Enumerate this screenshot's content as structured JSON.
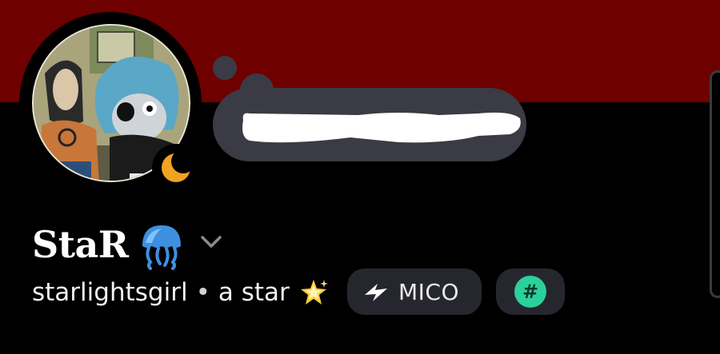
{
  "profile": {
    "display_name": "StaR",
    "name_emoji": "jellyfish-emoji",
    "username": "starlightsgirl",
    "separator": "•",
    "pronouns": "a star",
    "pronouns_emoji": "sparkle-star-emoji",
    "status": "idle-moon-icon",
    "custom_status": ""
  },
  "badges": [
    {
      "label": "MICO",
      "icon": "lightning-icon"
    },
    {
      "label": "#",
      "icon": "hashtag-icon"
    }
  ],
  "colors": {
    "banner": "#6e0000",
    "background": "#000000",
    "pill": "#26272e",
    "bubble": "#3a3b44",
    "hashtag_accent": "#2ad19b",
    "idle_moon": "#f0a322"
  }
}
